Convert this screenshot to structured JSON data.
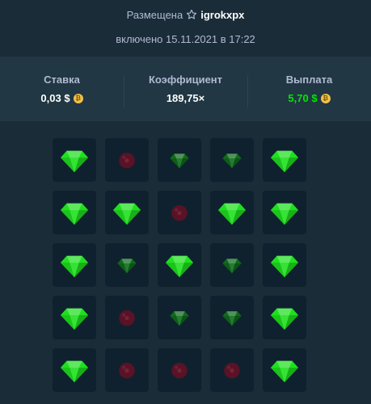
{
  "header": {
    "placed_label": "Размещена",
    "username": "igrokxpx",
    "date_line": "включено 15.11.2021 в 17:22"
  },
  "stats": {
    "bet_label": "Ставка",
    "bet_value": "0,03 $",
    "multiplier_label": "Коэффициент",
    "multiplier_value": "189,75×",
    "payout_label": "Выплата",
    "payout_value": "5,70 $",
    "payout_color": "#00e701"
  },
  "colors": {
    "background": "#1a2c38",
    "panel": "#213743",
    "tile": "#0f212e",
    "gem_bright": "#1fe01f",
    "gem_dim": "#0f6b1c",
    "mine_dim": "#5a1226"
  },
  "board": {
    "rows": [
      [
        "gem",
        "mine-dim",
        "gem-dim",
        "gem-dim",
        "gem"
      ],
      [
        "gem",
        "gem",
        "mine-dim",
        "gem",
        "gem"
      ],
      [
        "gem",
        "gem-dim",
        "gem",
        "gem-dim",
        "gem"
      ],
      [
        "gem",
        "mine-dim",
        "gem-dim",
        "gem-dim",
        "gem"
      ],
      [
        "gem",
        "mine-dim",
        "mine-dim",
        "mine-dim",
        "gem"
      ]
    ]
  }
}
